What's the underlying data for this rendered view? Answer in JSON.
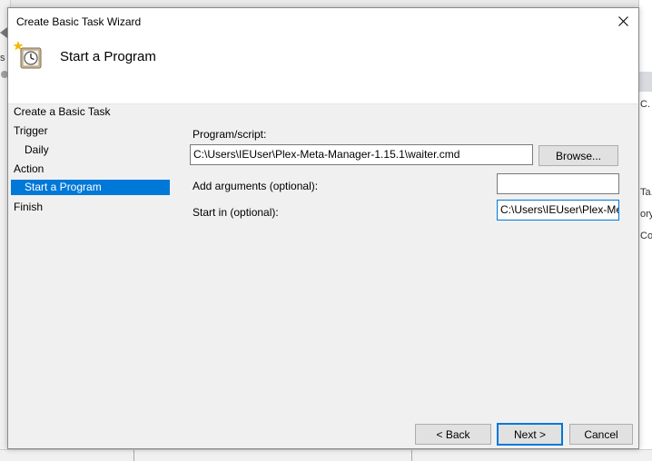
{
  "dialog": {
    "title": "Create Basic Task Wizard",
    "header_title": "Start a Program",
    "header_icon": "clock-icon",
    "close_icon": "close-icon"
  },
  "nav": {
    "items": [
      {
        "label": "Create a Basic Task",
        "level": 0,
        "selected": false
      },
      {
        "label": "Trigger",
        "level": 0,
        "selected": false
      },
      {
        "label": "Daily",
        "level": 1,
        "selected": false
      },
      {
        "label": "Action",
        "level": 0,
        "selected": false
      },
      {
        "label": "Start a Program",
        "level": 1,
        "selected": true
      },
      {
        "label": "Finish",
        "level": 0,
        "selected": false
      }
    ]
  },
  "form": {
    "program_label": "Program/script:",
    "program_value": "C:\\Users\\IEUser\\Plex-Meta-Manager-1.15.1\\waiter.cmd",
    "browse_label": "Browse...",
    "arguments_label": "Add arguments (optional):",
    "arguments_value": "",
    "start_in_label": "Start in (optional):",
    "start_in_value": "C:\\Users\\IEUser\\Plex-Me"
  },
  "footer": {
    "back_label": "< Back",
    "next_label": "Next >",
    "cancel_label": "Cancel"
  },
  "background": {
    "left_fragments": [
      "s"
    ],
    "right_fragments": [
      "C.",
      "Ta.",
      "ory",
      "Co."
    ]
  },
  "colors": {
    "selection": "#0078d7",
    "dialog_bg": "#f0f0f0",
    "header_bg": "#ffffff"
  }
}
